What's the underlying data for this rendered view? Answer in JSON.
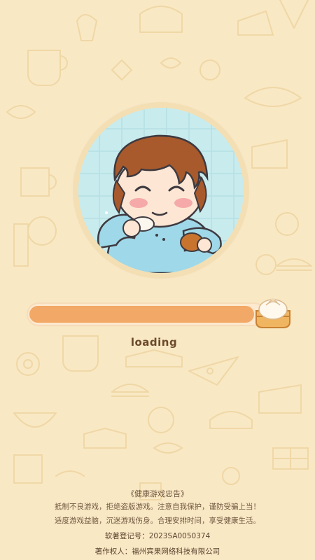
{
  "screen": {
    "background_color": "#f9e8c4",
    "accent_color": "#f2a866"
  },
  "splash": {
    "character": "cartoon-child-eating-icon",
    "loader_icon": "steamed-bun-icon",
    "progress_fraction": 0.96,
    "loading_text": "loading"
  },
  "health_notice": {
    "title": "《健康游戏忠告》",
    "line1": "抵制不良游戏，拒绝盗版游戏。注意自我保护，谨防受骗上当！",
    "line2": "适度游戏益脑，沉迷游戏伤身。合理安排时间，享受健康生活。"
  },
  "copyright": {
    "registration": "软著登记号：2023SA0050374",
    "owner": "著作权人：福州宾果网络科技有限公司"
  }
}
